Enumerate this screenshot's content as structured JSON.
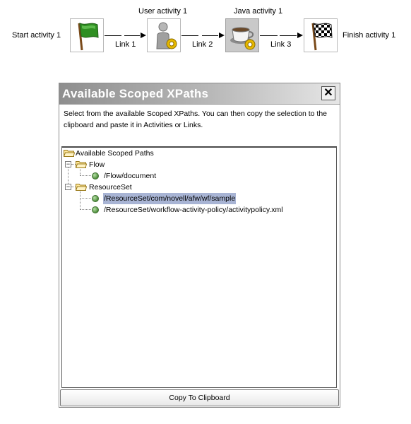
{
  "workflow": {
    "nodes": [
      {
        "id": "start",
        "label": "Start activity 1",
        "icon": "green-flag-icon"
      },
      {
        "id": "user",
        "label": "User activity 1",
        "icon": "user-gear-icon"
      },
      {
        "id": "java",
        "label": "Java activity 1",
        "icon": "coffee-cup-gear-icon"
      },
      {
        "id": "finish",
        "label": "Finish activity 1",
        "icon": "checkered-flag-icon"
      }
    ],
    "links": [
      "Link 1",
      "Link 2",
      "Link 3"
    ]
  },
  "dialog": {
    "title": "Available Scoped XPaths",
    "close": "✕",
    "instructions": "Select from the available Scoped XPaths.  You can then copy the selection to the clipboard and paste it in Activities or Links.",
    "tree": {
      "root": "Available Scoped Paths",
      "groups": [
        {
          "label": "Flow",
          "items": [
            "/Flow/document"
          ]
        },
        {
          "label": "ResourceSet",
          "items": [
            "/ResourceSet/com/novell/afw/wf/sample",
            "/ResourceSet/workflow-activity-policy/activitypolicy.xml"
          ]
        }
      ],
      "selected": "/ResourceSet/com/novell/afw/wf/sample"
    },
    "copy_button": "Copy To Clipboard"
  },
  "colors": {
    "title_gradient_start": "#8e8e8e",
    "title_gradient_end": "#e6e6e6",
    "selection": "#a8b4d4",
    "flag_green": "#2f8f22",
    "gear_yellow": "#e6b800"
  }
}
